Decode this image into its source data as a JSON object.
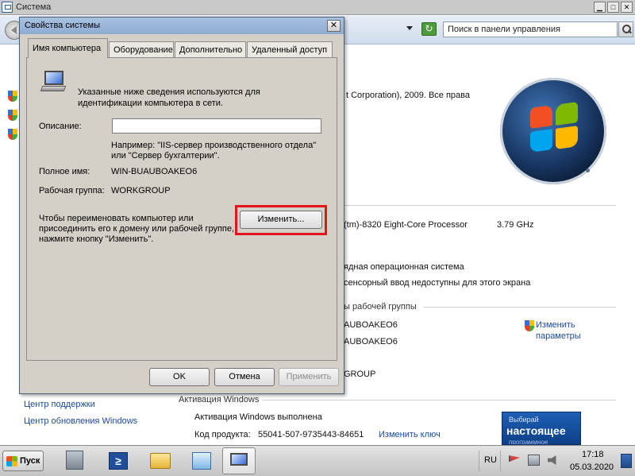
{
  "background_window": {
    "title": "Система",
    "search_placeholder": "Поиск в панели управления",
    "copyright_fragment": "t Corporation), 2009. Все права",
    "processor_fragment": "(tm)-8320 Eight-Core Processor",
    "processor_speed": "3.79 GHz",
    "system_type_fragment": "ядная операционная система",
    "pen_fragment": "сенсорный ввод недоступны для этого экрана",
    "group_header_fragment": "ы рабочей группы",
    "computer_name_fragment": "AUBOAKEO6",
    "full_name_fragment": "AUBOAKEO6",
    "workgroup_fragment": "GROUP",
    "change_settings_line1": "Изменить",
    "change_settings_line2": "параметры",
    "support_center": "Центр поддержки",
    "update_center": "Центр обновления Windows",
    "activation_header": "Активация Windows",
    "activation_status": "Активация Windows выполнена",
    "product_key_label": "Код продукта:",
    "product_key": "55041-507-9735443-84651",
    "change_key": "Изменить ключ",
    "badge_line1": "Выбирай",
    "badge_line2": "настоящее",
    "badge_line3": "программное обеспечение"
  },
  "dialog": {
    "title": "Свойства системы",
    "close_label": "✕",
    "tabs": [
      {
        "label": "Имя компьютера",
        "active": true
      },
      {
        "label": "Оборудование",
        "active": false
      },
      {
        "label": "Дополнительно",
        "active": false
      },
      {
        "label": "Удаленный доступ",
        "active": false
      }
    ],
    "intro_line1": "Указанные ниже сведения используются для",
    "intro_line2": "идентификации компьютера в сети.",
    "description_label": "Описание:",
    "description_value": "",
    "example_line1": "Например: \"IIS-сервер производственного отдела\"",
    "example_line2": "или \"Сервер бухгалтерии\".",
    "full_name_label": "Полное имя:",
    "full_name_value": "WIN-BUAUBOAKEO6",
    "workgroup_label": "Рабочая группа:",
    "workgroup_value": "WORKGROUP",
    "rename_line1": "Чтобы переименовать компьютер или",
    "rename_line2": "присоединить его к домену или рабочей группе,",
    "rename_line3": "нажмите кнопку \"Изменить\".",
    "change_button": "Изменить...",
    "ok_button": "OK",
    "cancel_button": "Отмена",
    "apply_button": "Применить"
  },
  "taskbar": {
    "start_label": "Пуск",
    "language": "RU",
    "time": "17:18",
    "date": "05.03.2020"
  },
  "colors": {
    "highlight_red": "#e3141c",
    "link_blue": "#1b4a9a",
    "dialog_face": "#d4d0c8"
  }
}
